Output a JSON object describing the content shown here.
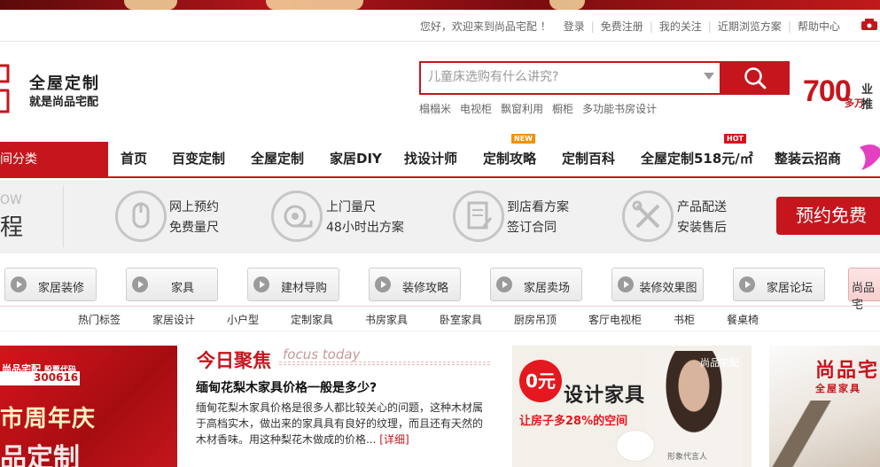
{
  "topbar": {
    "greeting": "您好，欢迎来到尚品宅配 ！",
    "login": "登录",
    "register": "免费注册",
    "follow": "我的关注",
    "recent": "近期浏览方案",
    "help": "帮助中心"
  },
  "logo": {
    "line1": "全屋定制",
    "line2": "就是尚品宅配"
  },
  "search": {
    "placeholder": "儿童床选购有什么讲究?",
    "hot_words": [
      "榻榻米",
      "电视柜",
      "飘窗利用",
      "橱柜",
      "多功能书房设计"
    ]
  },
  "promo": {
    "number": "700",
    "unit": "多万",
    "side1": "业",
    "side2": "推"
  },
  "nav": {
    "category": "间分类",
    "items": [
      {
        "label": "首页"
      },
      {
        "label": "百变定制"
      },
      {
        "label": "全屋定制"
      },
      {
        "label": "家居DIY"
      },
      {
        "label": "找设计师"
      },
      {
        "label": "定制攻略",
        "badge": "NEW"
      },
      {
        "label": "定制百科"
      },
      {
        "label": "全屋定制518元/㎡",
        "badge": "HOT"
      },
      {
        "label": "整装云招商"
      }
    ]
  },
  "process": {
    "flow_en": "OW",
    "flow_cn": "程",
    "steps": [
      {
        "icon": "mouse-icon",
        "line1": "网上预约",
        "line2": "免费量尺"
      },
      {
        "icon": "tape-measure-icon",
        "line1": "上门量尺",
        "line2": "48小时出方案"
      },
      {
        "icon": "contract-icon",
        "line1": "到店看方案",
        "line2": "签订合同"
      },
      {
        "icon": "tools-icon",
        "line1": "产品配送",
        "line2": "安装售后"
      }
    ],
    "book_button": "预约免费"
  },
  "channels": [
    "家居装修",
    "家具",
    "建材导购",
    "装修攻略",
    "家居卖场",
    "装修效果图",
    "家居论坛",
    "尚品宅"
  ],
  "subnav": [
    "热门标签",
    "家居设计",
    "小户型",
    "定制家具",
    "书房家具",
    "卧室家具",
    "厨房吊顶",
    "客厅电视柜",
    "书柜",
    "餐桌椅"
  ],
  "left_banner": {
    "logo": "尚品宅配",
    "stock_label": "股票代码",
    "stock_code": "300616",
    "headline": "市周年庆",
    "headline2": "品定制"
  },
  "focus": {
    "title": "今日聚焦",
    "title_en": "focus today",
    "article_title": "缅甸花梨木家具价格一般是多少?",
    "article_body": "缅甸花梨木家具价格是很多人都比较关心的问题，这种木材属于高档实木，做出来的家具具有良好的纹理，而且还有天然的木材香味。用这种梨花木做成的价格...",
    "more": "[详细]"
  },
  "ad": {
    "zero": "0元",
    "title": "设计家具",
    "subtitle": "让房子多28%的空间",
    "brand": "尚品宅配",
    "caption": "形象代言人"
  },
  "right_box": {
    "logo": "尚品宅",
    "sub": "全屋家具"
  },
  "colors": {
    "brand_red": "#c5161d",
    "badge_new": "#f29100",
    "badge_hot": "#d8121b"
  }
}
